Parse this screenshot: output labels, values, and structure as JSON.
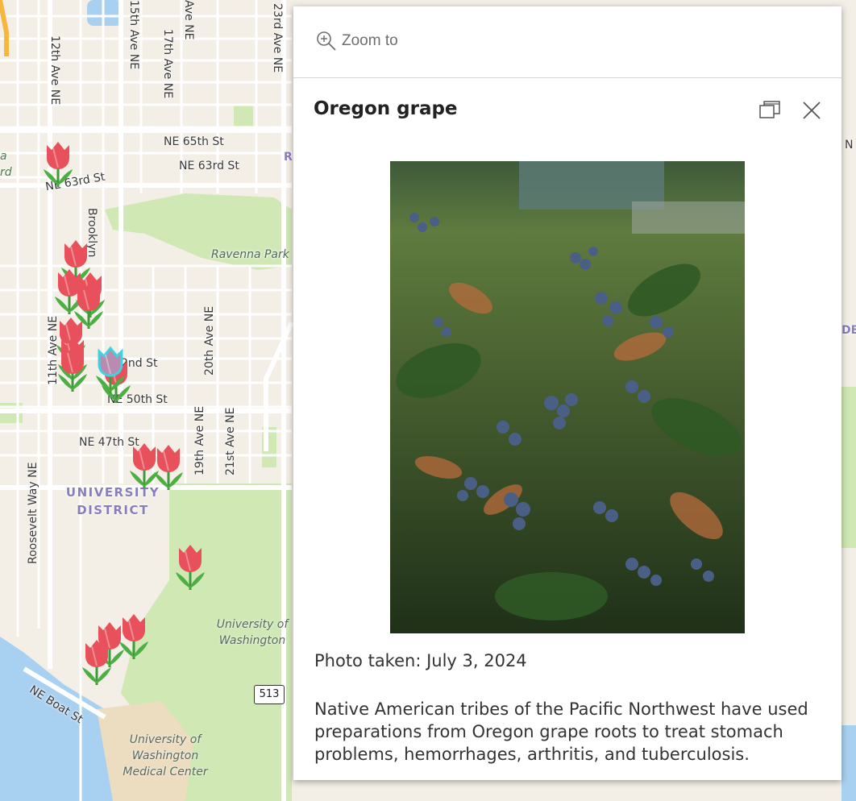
{
  "map": {
    "streets": {
      "ave_12th": "12th Ave NE",
      "ave_15th": "15th Ave NE",
      "ave_17th": "17th Ave NE",
      "ave_ne_partial": "Ave NE",
      "ave_23rd": "23rd Ave NE",
      "ne_65th": "NE 65th St",
      "ne_63rd": "NE 63rd St",
      "ne_63rd_left": "NE 63rd St",
      "brooklyn": "Brooklyn",
      "ravenna_park": "Ravenna Park",
      "ave_20th": "20th Ave NE",
      "ave_11th": "11th Ave NE",
      "ne_52nd": "2nd St",
      "ne_50th": "NE 50th St",
      "ne_47th": "NE 47th St",
      "ave_19th": "19th Ave NE",
      "ave_21st": "21st Ave NE",
      "roosevelt": "Roosevelt Way NE",
      "ne_boat": "NE Boat St",
      "left_edge_a": "a",
      "left_edge_rd": "rd",
      "right_edge_n": "N",
      "right_edge_de": "DE",
      "r_partial": "R"
    },
    "district_line1": "UNIVERSITY",
    "district_line2": "DISTRICT",
    "uw_line1": "University of",
    "uw_line2": "Washington",
    "uwmc_line1": "University of",
    "uwmc_line2": "Washington",
    "uwmc_line3": "Medical Center",
    "highway_shield": "513",
    "marker_count": 17,
    "marker_icon": "tulip-icon",
    "selected_marker_icon": "tulip-selected-icon"
  },
  "popup": {
    "zoom_to_label": "Zoom to",
    "zoom_icon": "zoom-in-icon",
    "title": "Oregon grape",
    "dock_icon": "dock-icon",
    "close_icon": "close-icon",
    "photo_alt": "Oregon grape shrub with clusters of blue berries",
    "caption": "Photo taken: July 3, 2024",
    "description": "Native American tribes of the Pacific Northwest have used preparations from Oregon grape roots to treat stomach problems, hemorrhages, arthritis, and tuberculosis."
  },
  "colors": {
    "land": "#f3eee6",
    "park": "#cfe8b4",
    "water": "#a8d0f0",
    "street": "#ffffff",
    "district_label": "#8a7dbd",
    "marker_red": "#e8505b",
    "marker_selected": "#3fd3e0"
  }
}
